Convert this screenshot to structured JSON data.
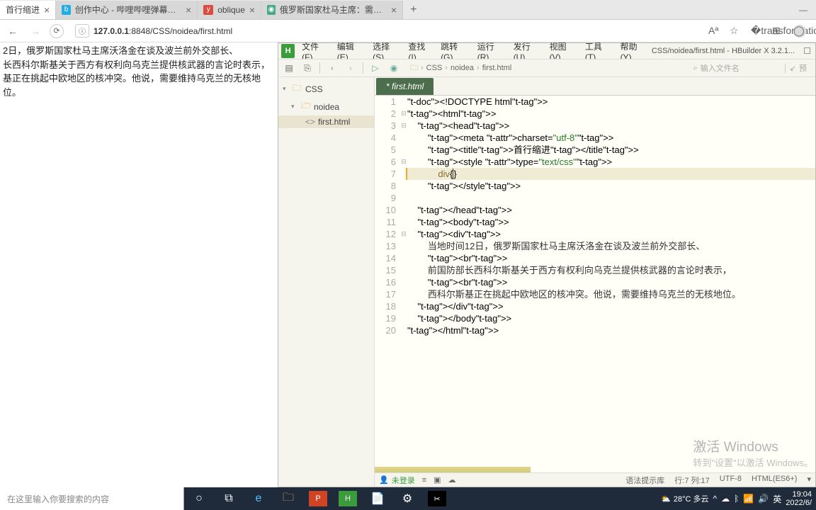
{
  "browser": {
    "tabs": [
      {
        "title": "首行缩进",
        "active": true
      },
      {
        "title": "创作中心 - 哔哩哔哩弹幕视频网",
        "active": false,
        "icon": "bili"
      },
      {
        "title": "oblique",
        "active": false,
        "icon": "y"
      },
      {
        "title": "俄罗斯国家杜马主席：需要维持…",
        "active": false,
        "icon": "globe"
      }
    ],
    "url_prefix": "127.0.0.1",
    "url_rest": ":8848/CSS/noidea/first.html",
    "info_icon": "ⓘ"
  },
  "rendered": {
    "line1": "2日，俄罗斯国家杜马主席沃洛金在谈及波兰前外交部长、",
    "line2": "长西科尔斯基关于西方有权利向乌克兰提供核武器的言论时表示，",
    "line3": "基正在挑起中欧地区的核冲突。他说，需要维持乌克兰的无核地位。"
  },
  "ide": {
    "menus": [
      "文件(F)",
      "编辑(E)",
      "选择(S)",
      "查找(I)",
      "跳转(G)",
      "运行(R)",
      "发行(U)",
      "视图(V)",
      "工具(T)",
      "帮助(Y)"
    ],
    "title": "CSS/noidea/first.html - HBuilder X 3.2.1...",
    "breadcrumb": [
      "CSS",
      "noidea",
      "first.html"
    ],
    "searchPlaceholder": "输入文件名",
    "preview": "预",
    "tree": {
      "root": "CSS",
      "folder": "noidea",
      "file": "first.html"
    },
    "tab": "* first.html",
    "code": {
      "l1": "<!DOCTYPE html>",
      "l2": "<html>",
      "l3": "    <head>",
      "l4": "        <meta charset=\"utf-8\">",
      "l5": "        <title>首行缩进</title>",
      "l6": "        <style type=\"text/css\">",
      "l7_pre": "            div{",
      "l7_post": "}",
      "l8": "        </style>",
      "l9": "",
      "l10": "    </head>",
      "l11": "    <body>",
      "l12": "    <div>",
      "l13": "        当地时间12日，俄罗斯国家杜马主席沃洛金在谈及波兰前外交部长、",
      "l14": "        <br>",
      "l15": "        前国防部长西科尔斯基关于西方有权利向乌克兰提供核武器的言论时表示，",
      "l16": "        <br>",
      "l17": "        西科尔斯基正在挑起中欧地区的核冲突。他说，需要维持乌克兰的无核地位。",
      "l18": "    </div>",
      "l19": "    </body>",
      "l20": "</html>"
    },
    "status": {
      "login": "未登录",
      "hint": "语法提示库",
      "pos": "行:7  列:17",
      "enc": "UTF-8",
      "lang": "HTML(ES6+)"
    }
  },
  "watermark": {
    "big": "激活 Windows",
    "small": "转到\"设置\"以激活 Windows。"
  },
  "taskbar": {
    "search": "在这里输入你要搜索的内容",
    "weather": "28°C 多云",
    "ime": "英",
    "time": "19:04",
    "date": "2022/6/"
  }
}
